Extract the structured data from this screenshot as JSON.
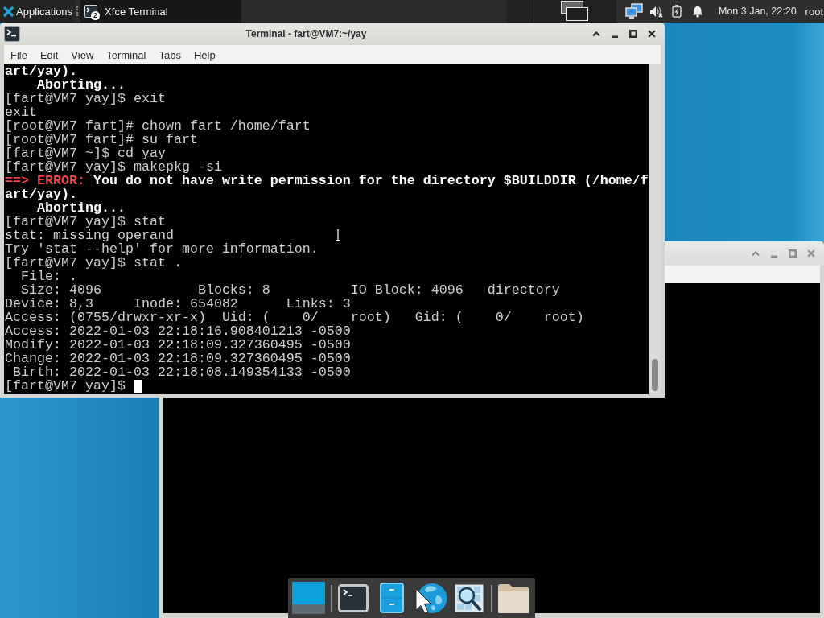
{
  "top_panel": {
    "applications": "Applications",
    "taskbar": [
      {
        "label": "Xfce Terminal",
        "badge": "2",
        "selected": true
      }
    ],
    "clock": "Mon 3 Jan, 22:20",
    "user": "root"
  },
  "terminal_window": {
    "title": "Terminal - fart@VM7:~/yay",
    "menu": [
      "File",
      "Edit",
      "View",
      "Terminal",
      "Tabs",
      "Help"
    ],
    "lines": [
      {
        "text": "art/yay).",
        "bold": true
      },
      {
        "text": "    Aborting...",
        "bold": true
      },
      {
        "text": "[fart@VM7 yay]$ exit",
        "bold": false
      },
      {
        "text": "exit",
        "bold": false
      },
      {
        "text": "[root@VM7 fart]# chown fart /home/fart",
        "bold": false
      },
      {
        "text": "[root@VM7 fart]# su fart",
        "bold": false
      },
      {
        "text": "[fart@VM7 ~]$ cd yay",
        "bold": false
      },
      {
        "text": "[fart@VM7 yay]$ makepkg -si",
        "bold": false
      },
      {
        "error_prefix": "==> ERROR:",
        "text": " You do not have write permission for the directory $BUILDDIR (/home/f",
        "bold": true
      },
      {
        "text": "art/yay).",
        "bold": true
      },
      {
        "text": "    Aborting...",
        "bold": true
      },
      {
        "text": "[fart@VM7 yay]$ stat",
        "bold": false
      },
      {
        "text": "stat: missing operand",
        "bold": false
      },
      {
        "text": "Try 'stat --help' for more information.",
        "bold": false
      },
      {
        "text": "[fart@VM7 yay]$ stat .",
        "bold": false
      },
      {
        "text": "  File: .",
        "bold": false
      },
      {
        "text": "  Size: 4096            Blocks: 8          IO Block: 4096   directory",
        "bold": false
      },
      {
        "text": "Device: 8,3     Inode: 654082      Links: 3",
        "bold": false
      },
      {
        "text": "Access: (0755/drwxr-xr-x)  Uid: (    0/    root)   Gid: (    0/    root)",
        "bold": false
      },
      {
        "text": "Access: 2022-01-03 22:18:16.908401213 -0500",
        "bold": false
      },
      {
        "text": "Modify: 2022-01-03 22:18:09.327360495 -0500",
        "bold": false
      },
      {
        "text": "Change: 2022-01-03 22:18:09.327360495 -0500",
        "bold": false
      },
      {
        "text": " Birth: 2022-01-03 22:18:08.149354133 -0500",
        "bold": false
      },
      {
        "text": "[fart@VM7 yay]$",
        "bold": false,
        "cursor": true
      }
    ]
  }
}
